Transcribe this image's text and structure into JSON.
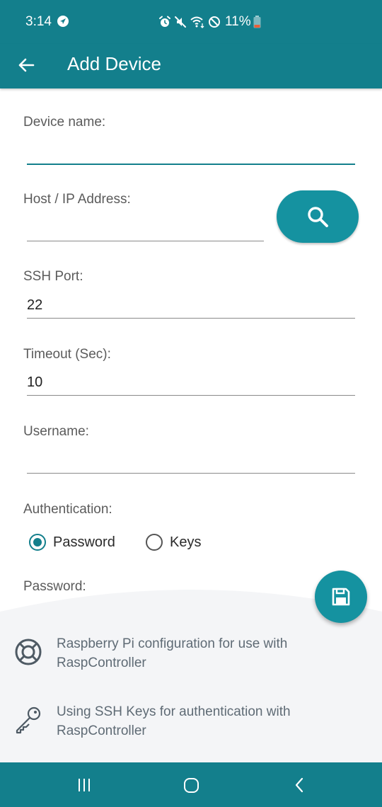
{
  "status_bar": {
    "time": "3:14",
    "battery": "11%",
    "icons": [
      "location-icon",
      "alarm-icon",
      "mute-icon",
      "wifi-icon",
      "dnd-icon",
      "battery-icon"
    ]
  },
  "app_bar": {
    "title": "Add Device",
    "back_icon": "arrow-left-icon"
  },
  "form": {
    "device_name": {
      "label": "Device name:",
      "value": ""
    },
    "host": {
      "label": "Host / IP Address:",
      "value": ""
    },
    "ssh_port": {
      "label": "SSH Port:",
      "value": "22"
    },
    "timeout": {
      "label": "Timeout (Sec):",
      "value": "10"
    },
    "username": {
      "label": "Username:",
      "value": ""
    },
    "authentication": {
      "label": "Authentication:",
      "options": [
        {
          "label": "Password",
          "selected": true
        },
        {
          "label": "Keys",
          "selected": false
        }
      ]
    },
    "password": {
      "label": "Password:"
    }
  },
  "search_button": {
    "icon": "search-icon"
  },
  "save_button": {
    "icon": "save-icon"
  },
  "help": {
    "items": [
      {
        "icon": "lifebuoy-icon",
        "text": "Raspberry Pi configuration for use with RaspController"
      },
      {
        "icon": "key-icon",
        "text": "Using SSH Keys for authentication with RaspController"
      }
    ]
  },
  "colors": {
    "primary": "#137f8c",
    "accent": "#1592a0",
    "sheet": "#f4f5f7"
  },
  "nav_bar": {
    "buttons": [
      "recents-icon",
      "home-icon",
      "back-icon"
    ]
  }
}
